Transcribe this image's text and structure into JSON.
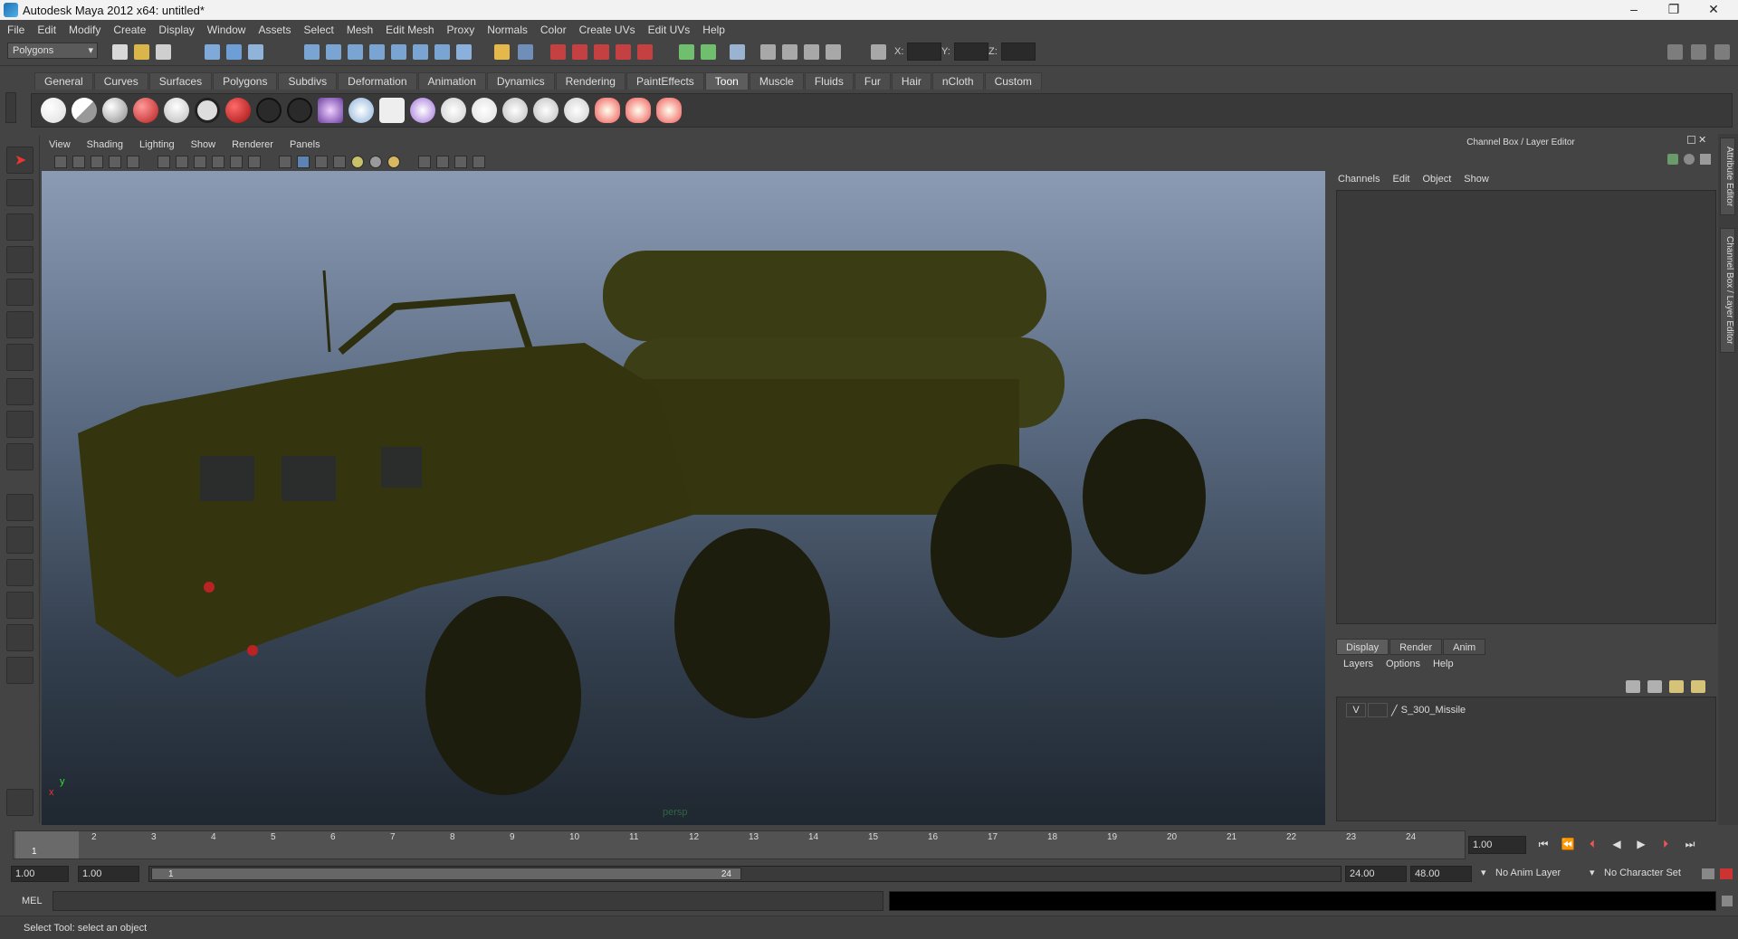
{
  "window": {
    "title": "Autodesk Maya 2012 x64: untitled*"
  },
  "menubar": {
    "items": [
      "File",
      "Edit",
      "Modify",
      "Create",
      "Display",
      "Window",
      "Assets",
      "Select",
      "Mesh",
      "Edit Mesh",
      "Proxy",
      "Normals",
      "Color",
      "Create UVs",
      "Edit UVs",
      "Help"
    ]
  },
  "statusline": {
    "mode": "Polygons",
    "x_label": "X:",
    "y_label": "Y:",
    "z_label": "Z:"
  },
  "shelf": {
    "tabs": [
      "General",
      "Curves",
      "Surfaces",
      "Polygons",
      "Subdivs",
      "Deformation",
      "Animation",
      "Dynamics",
      "Rendering",
      "PaintEffects",
      "Toon",
      "Muscle",
      "Fluids",
      "Fur",
      "Hair",
      "nCloth",
      "Custom"
    ],
    "active_tab": "Toon"
  },
  "viewport": {
    "menus": [
      "View",
      "Shading",
      "Lighting",
      "Show",
      "Renderer",
      "Panels"
    ],
    "camera_label": "persp",
    "axis_x": "x",
    "axis_y": "y"
  },
  "channel_box": {
    "title": "Channel Box / Layer Editor",
    "menus": [
      "Channels",
      "Edit",
      "Object",
      "Show"
    ]
  },
  "layer_editor": {
    "tabs": [
      "Display",
      "Render",
      "Anim"
    ],
    "active_tab": "Display",
    "menus": [
      "Layers",
      "Options",
      "Help"
    ],
    "layers": [
      {
        "visible": "V",
        "name": "S_300_Missile"
      }
    ]
  },
  "side_tabs": [
    "Attribute Editor",
    "Channel Box / Layer Editor"
  ],
  "timeline": {
    "ticks": [
      "1",
      "2",
      "3",
      "4",
      "5",
      "6",
      "7",
      "8",
      "9",
      "10",
      "11",
      "12",
      "13",
      "14",
      "15",
      "16",
      "17",
      "18",
      "19",
      "20",
      "21",
      "22",
      "23",
      "24"
    ],
    "current_marker": "1",
    "current_frame": "1.00"
  },
  "range": {
    "start": "1.00",
    "anim_start": "1.00",
    "slider_start": "1",
    "slider_end": "24",
    "end": "24.00",
    "anim_end": "48.00",
    "anim_layer": "No Anim Layer",
    "character_set": "No Character Set"
  },
  "command_line": {
    "label": "MEL"
  },
  "status": {
    "message": "Select Tool: select an object"
  }
}
